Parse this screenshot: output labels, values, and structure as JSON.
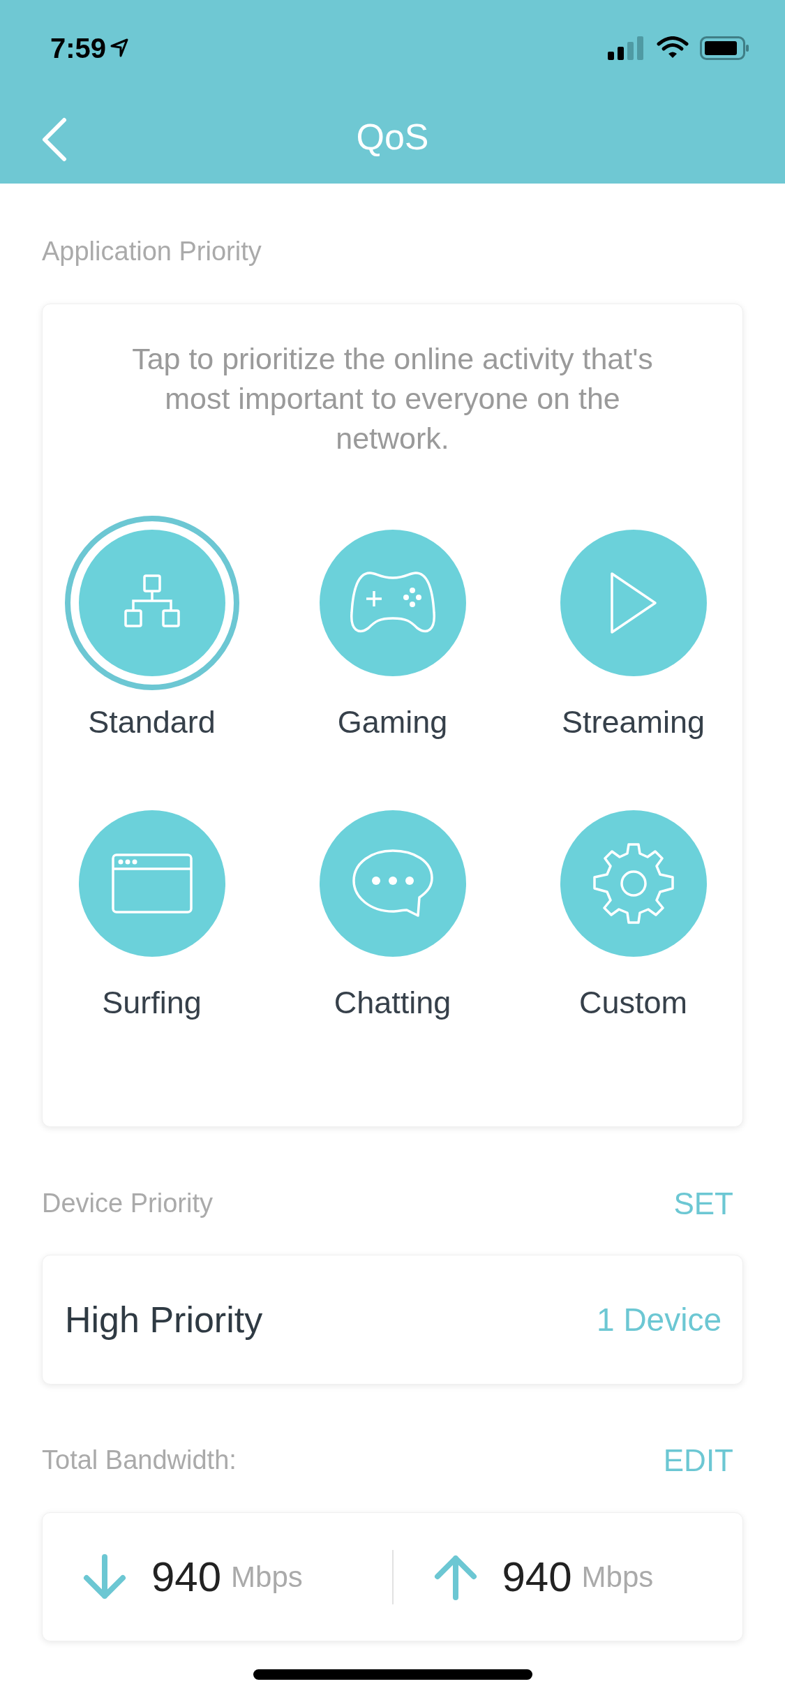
{
  "status_bar": {
    "time": "7:59"
  },
  "nav": {
    "title": "QoS"
  },
  "application_priority": {
    "label": "Application Priority",
    "description": "Tap to prioritize the online activity that's most important to everyone on the network.",
    "modes": [
      {
        "kind": "standard",
        "label": "Standard",
        "selected": true
      },
      {
        "kind": "gaming",
        "label": "Gaming",
        "selected": false
      },
      {
        "kind": "streaming",
        "label": "Streaming",
        "selected": false
      },
      {
        "kind": "surfing",
        "label": "Surfing",
        "selected": false
      },
      {
        "kind": "chatting",
        "label": "Chatting",
        "selected": false
      },
      {
        "kind": "custom",
        "label": "Custom",
        "selected": false
      }
    ]
  },
  "device_priority": {
    "label": "Device Priority",
    "action": "SET",
    "row": {
      "title": "High Priority",
      "value": "1 Device"
    }
  },
  "total_bandwidth": {
    "label": "Total Bandwidth:",
    "action": "EDIT",
    "download": {
      "value": "940",
      "unit": "Mbps"
    },
    "upload": {
      "value": "940",
      "unit": "Mbps"
    }
  }
}
